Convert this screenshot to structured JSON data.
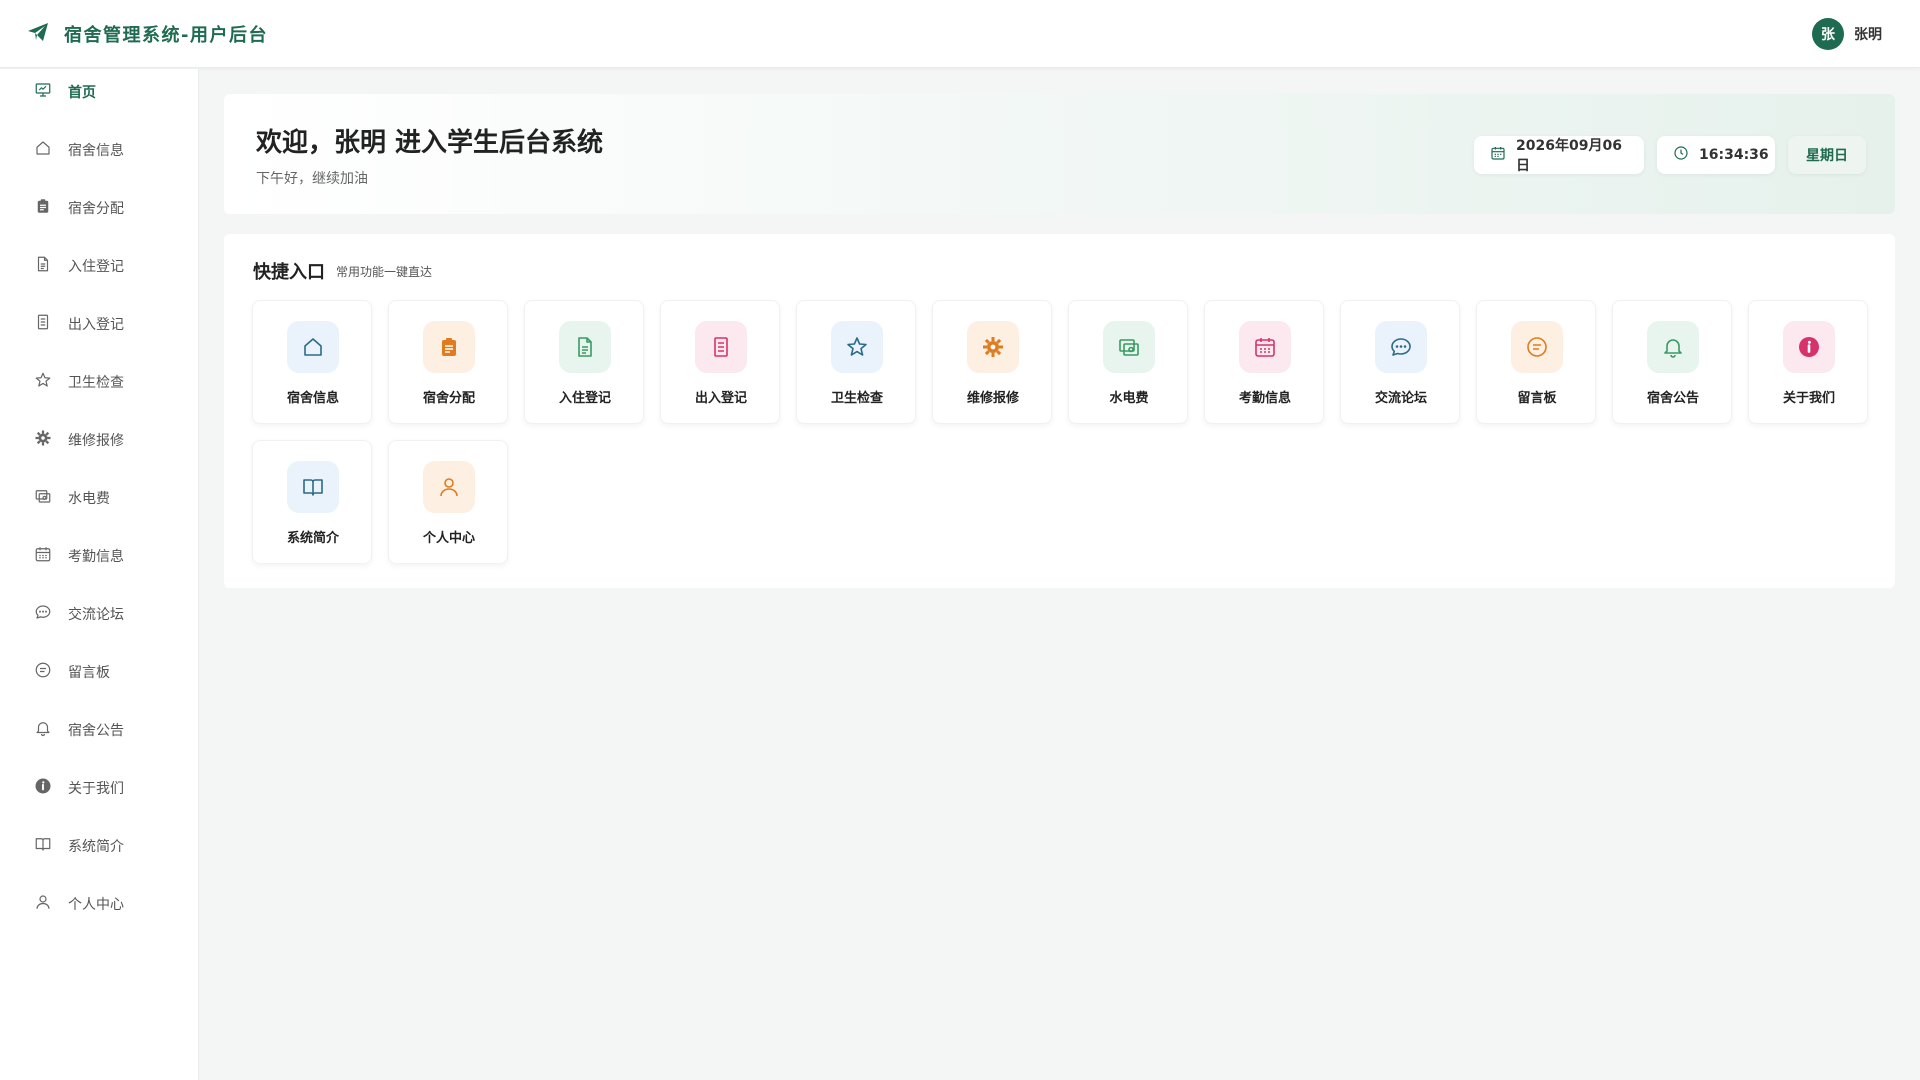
{
  "header": {
    "title": "宿舍管理系统-用户后台",
    "avatar_initial": "张",
    "user_name": "张明"
  },
  "sidebar": {
    "items": [
      {
        "label": "首页",
        "icon": "presentation-icon",
        "active": true
      },
      {
        "label": "宿舍信息",
        "icon": "home-icon"
      },
      {
        "label": "宿舍分配",
        "icon": "clipboard-icon"
      },
      {
        "label": "入住登记",
        "icon": "document-icon"
      },
      {
        "label": "出入登记",
        "icon": "list-document-icon"
      },
      {
        "label": "卫生检查",
        "icon": "star-icon"
      },
      {
        "label": "维修报修",
        "icon": "gear-icon"
      },
      {
        "label": "水电费",
        "icon": "money-icon"
      },
      {
        "label": "考勤信息",
        "icon": "calendar-icon"
      },
      {
        "label": "交流论坛",
        "icon": "chat-bubble-icon"
      },
      {
        "label": "留言板",
        "icon": "message-icon"
      },
      {
        "label": "宿舍公告",
        "icon": "bell-icon"
      },
      {
        "label": "关于我们",
        "icon": "info-icon"
      },
      {
        "label": "系统简介",
        "icon": "book-icon"
      },
      {
        "label": "个人中心",
        "icon": "user-icon"
      }
    ]
  },
  "welcome": {
    "title": "欢迎，张明 进入学生后台系统",
    "subtitle": "下午好，继续加油",
    "date": "2026年09月06日",
    "time": "16:34:36",
    "weekday": "星期日"
  },
  "quick": {
    "title": "快捷入口",
    "subtitle": "常用功能一键直达",
    "tiles": [
      {
        "label": "宿舍信息",
        "icon": "home-icon",
        "color": "#2b6b8a",
        "bg": "#eaf3fb"
      },
      {
        "label": "宿舍分配",
        "icon": "clipboard-icon",
        "color": "#e07b1f",
        "bg": "#fdf0e2"
      },
      {
        "label": "入住登记",
        "icon": "document-icon",
        "color": "#3a9a63",
        "bg": "#e8f5ee"
      },
      {
        "label": "出入登记",
        "icon": "list-document-icon",
        "color": "#d6336c",
        "bg": "#fce8ef"
      },
      {
        "label": "卫生检查",
        "icon": "star-icon",
        "color": "#2b6b8a",
        "bg": "#eaf3fb"
      },
      {
        "label": "维修报修",
        "icon": "gear-icon",
        "color": "#e07b1f",
        "bg": "#fdf0e2"
      },
      {
        "label": "水电费",
        "icon": "money-icon",
        "color": "#3a9a63",
        "bg": "#e8f5ee"
      },
      {
        "label": "考勤信息",
        "icon": "calendar-icon",
        "color": "#d6336c",
        "bg": "#fce8ef"
      },
      {
        "label": "交流论坛",
        "icon": "chat-bubble-icon",
        "color": "#2b6b8a",
        "bg": "#eaf3fb"
      },
      {
        "label": "留言板",
        "icon": "message-icon",
        "color": "#e07b1f",
        "bg": "#fdf0e2"
      },
      {
        "label": "宿舍公告",
        "icon": "bell-icon",
        "color": "#3a9a63",
        "bg": "#e8f5ee"
      },
      {
        "label": "关于我们",
        "icon": "info-icon",
        "color": "#d6336c",
        "bg": "#fce8ef"
      },
      {
        "label": "系统简介",
        "icon": "book-icon",
        "color": "#2b6b8a",
        "bg": "#eaf3fb"
      },
      {
        "label": "个人中心",
        "icon": "user-icon",
        "color": "#e07b1f",
        "bg": "#fdf0e2"
      }
    ]
  },
  "colors": {
    "brand": "#1f6b52",
    "sidebar_icon": "#666666",
    "background": "#f4f6f5"
  }
}
